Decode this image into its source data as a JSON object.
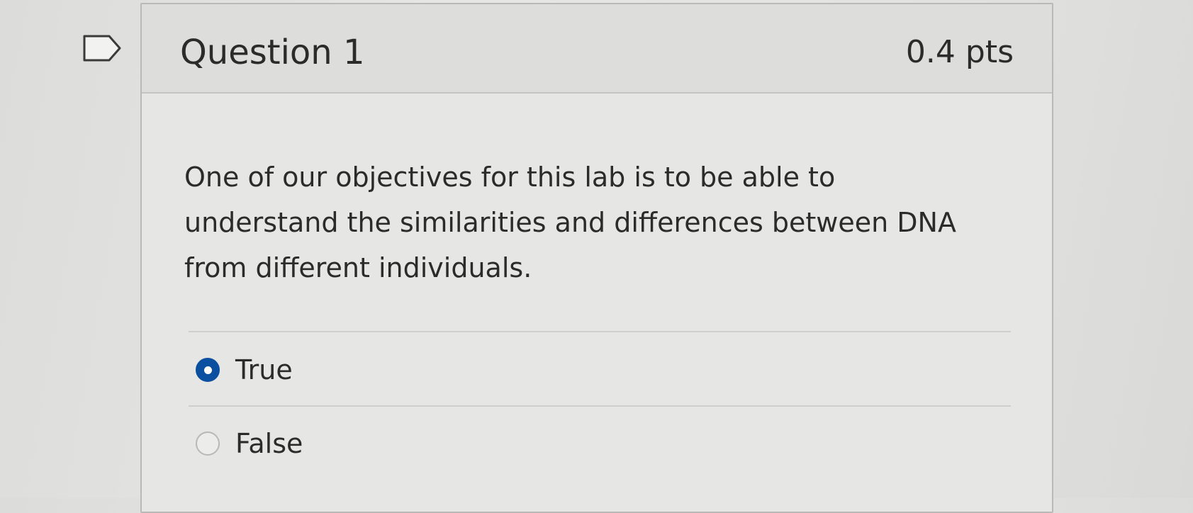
{
  "question": {
    "title": "Question 1",
    "points": "0.4 pts",
    "text": "One of our objectives for this lab is to be able to understand the similarities and differences between DNA from different individuals.",
    "answers": [
      {
        "label": "True",
        "selected": true
      },
      {
        "label": "False",
        "selected": false
      }
    ]
  },
  "colors": {
    "selected_radio": "#0a4fa0",
    "text": "#2b2b2b"
  }
}
